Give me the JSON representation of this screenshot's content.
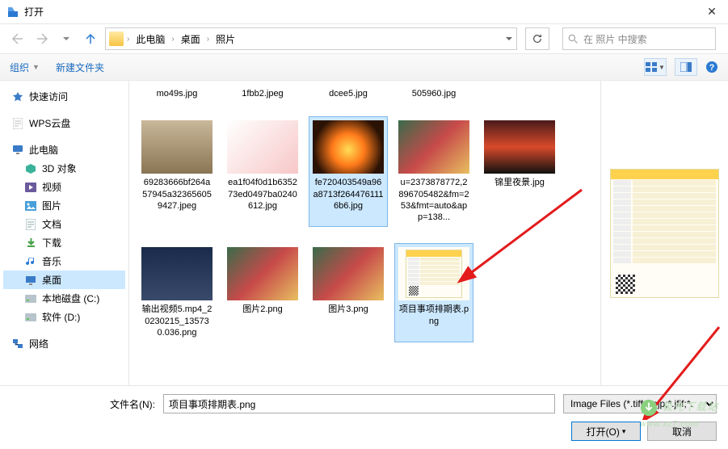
{
  "title": "打开",
  "breadcrumb": [
    "此电脑",
    "桌面",
    "照片"
  ],
  "search_placeholder": "在 照片 中搜索",
  "toolbar": {
    "organize": "组织",
    "new_folder": "新建文件夹"
  },
  "sidebar": {
    "quick": "快速访问",
    "wps": "WPS云盘",
    "this_pc": "此电脑",
    "children": [
      {
        "label": "3D 对象",
        "icon": "cube"
      },
      {
        "label": "视频",
        "icon": "video"
      },
      {
        "label": "图片",
        "icon": "pic"
      },
      {
        "label": "文档",
        "icon": "doc"
      },
      {
        "label": "下载",
        "icon": "down"
      },
      {
        "label": "音乐",
        "icon": "music"
      },
      {
        "label": "桌面",
        "icon": "desktop",
        "selected": true
      },
      {
        "label": "本地磁盘 (C:)",
        "icon": "disk"
      },
      {
        "label": "软件 (D:)",
        "icon": "disk"
      }
    ],
    "network": "网络"
  },
  "filesRow1": [
    {
      "name": "mo49s.jpg",
      "thumb": "gray"
    },
    {
      "name": "1fbb2.jpeg",
      "thumb": "gray"
    },
    {
      "name": "dcee5.jpg",
      "thumb": "gray"
    },
    {
      "name": "505960.jpg",
      "thumb": "gray"
    }
  ],
  "filesRow2": [
    {
      "name": "69283666bf264a57945a323656059427.jpeg",
      "thumb": "man"
    },
    {
      "name": "ea1f04f0d1b635273ed0497ba0240612.jpg",
      "thumb": "grad"
    },
    {
      "name": "fe720403549a96a8713f2644761116b6.jpg",
      "thumb": "fire",
      "selected": true
    },
    {
      "name": "u=2373878772,2896705482&fm=253&fmt=auto&app=138...",
      "thumb": "anime"
    },
    {
      "name": "锦里夜景.jpg",
      "thumb": "lantern"
    }
  ],
  "filesRow3": [
    {
      "name": "输出视频5.mp4_20230215_135730.036.png",
      "thumb": "dark"
    },
    {
      "name": "图片2.png",
      "thumb": "anime"
    },
    {
      "name": "图片3.png",
      "thumb": "anime"
    },
    {
      "name": "项目事项排期表.png",
      "thumb": "sheet",
      "selected": true
    }
  ],
  "footer": {
    "filename_label": "文件名(N):",
    "filename_value": "项目事项排期表.png",
    "filter": "Image Files (*.tiff;*.pjp;*.jfif;*.",
    "open": "打开(O)",
    "cancel": "取消"
  },
  "watermark": "极光下载站\nwww.xz7.com"
}
